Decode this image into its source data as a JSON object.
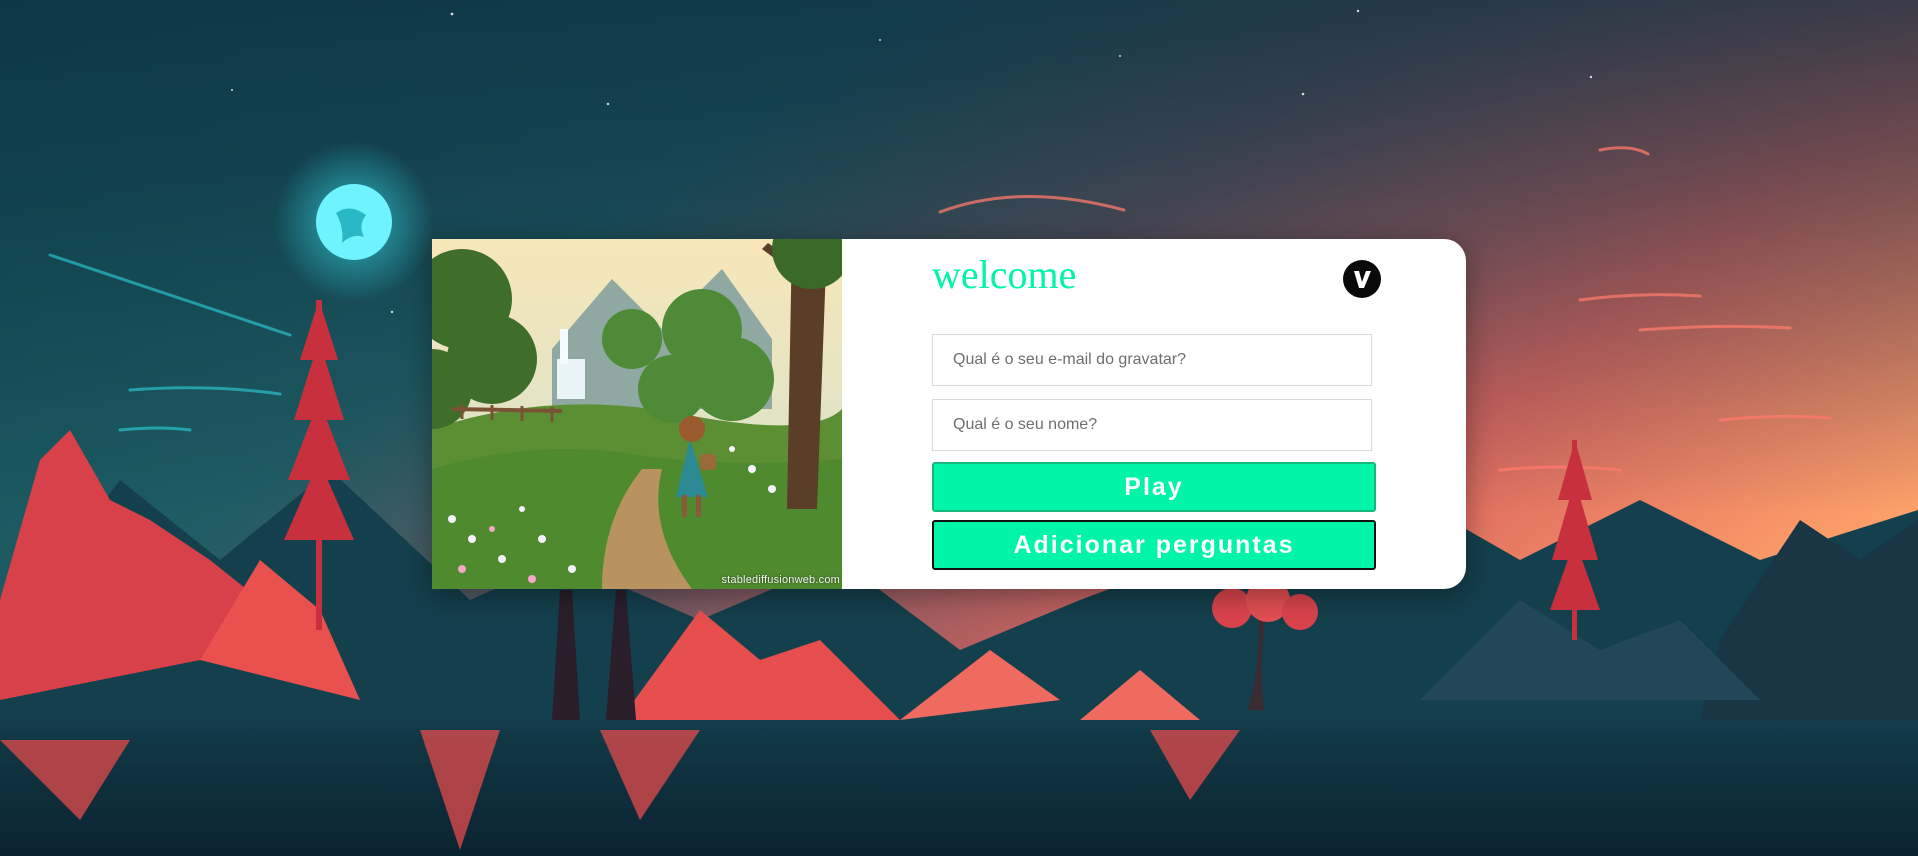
{
  "card": {
    "title": "welcome",
    "image_watermark": "stablediffusionweb.com",
    "logo_letter": "V",
    "email_placeholder": "Qual é o seu e-mail do gravatar?",
    "name_placeholder": "Qual é o seu nome?",
    "play_label": "Play",
    "add_questions_label": "Adicionar perguntas"
  },
  "colors": {
    "accent": "#00f5a8",
    "card_background": "#ffffff",
    "logo_background": "#0a0a0a"
  },
  "icons": {
    "logo": "v-logo-icon",
    "moon": "moon-icon"
  }
}
